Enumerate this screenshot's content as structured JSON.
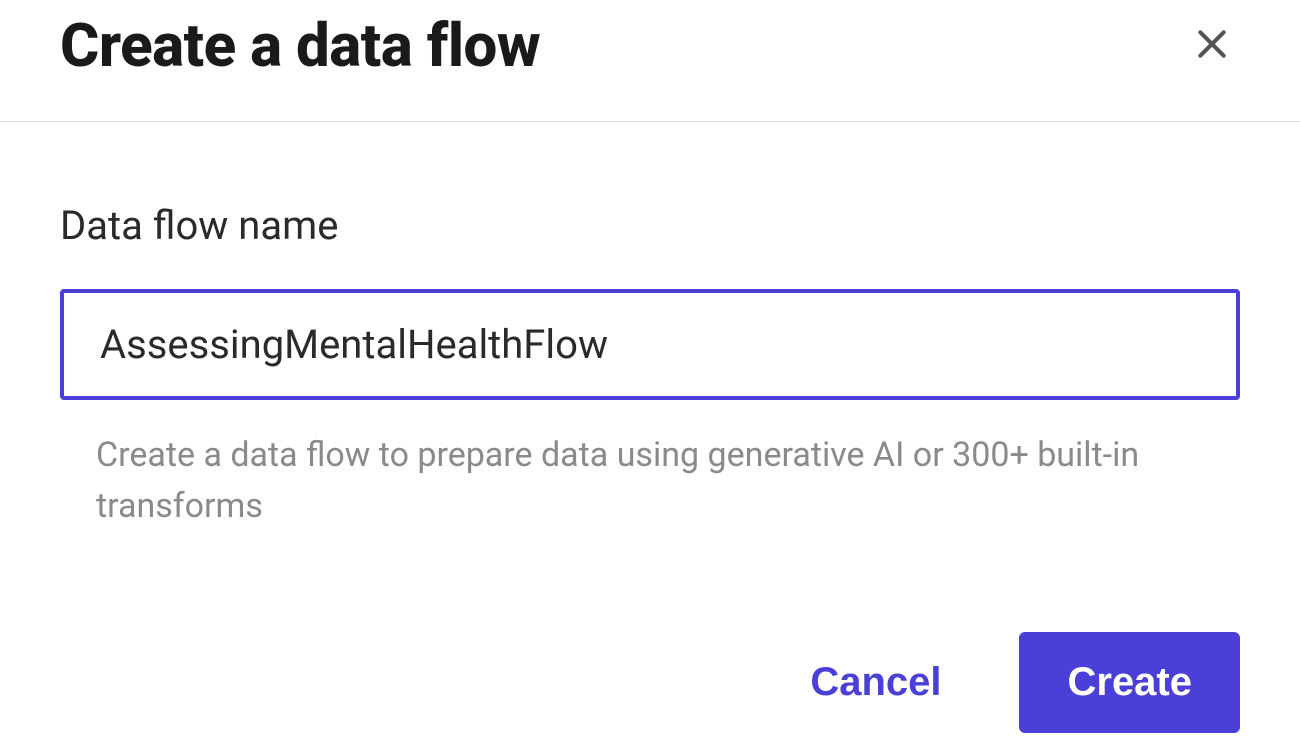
{
  "dialog": {
    "title": "Create a data flow",
    "field_label": "Data flow name",
    "input_value": "AssessingMentalHealthFlow",
    "helper_text": "Create a data flow to prepare data using generative AI or 300+ built-in transforms",
    "cancel_label": "Cancel",
    "create_label": "Create"
  },
  "colors": {
    "accent": "#4a3fd6"
  }
}
